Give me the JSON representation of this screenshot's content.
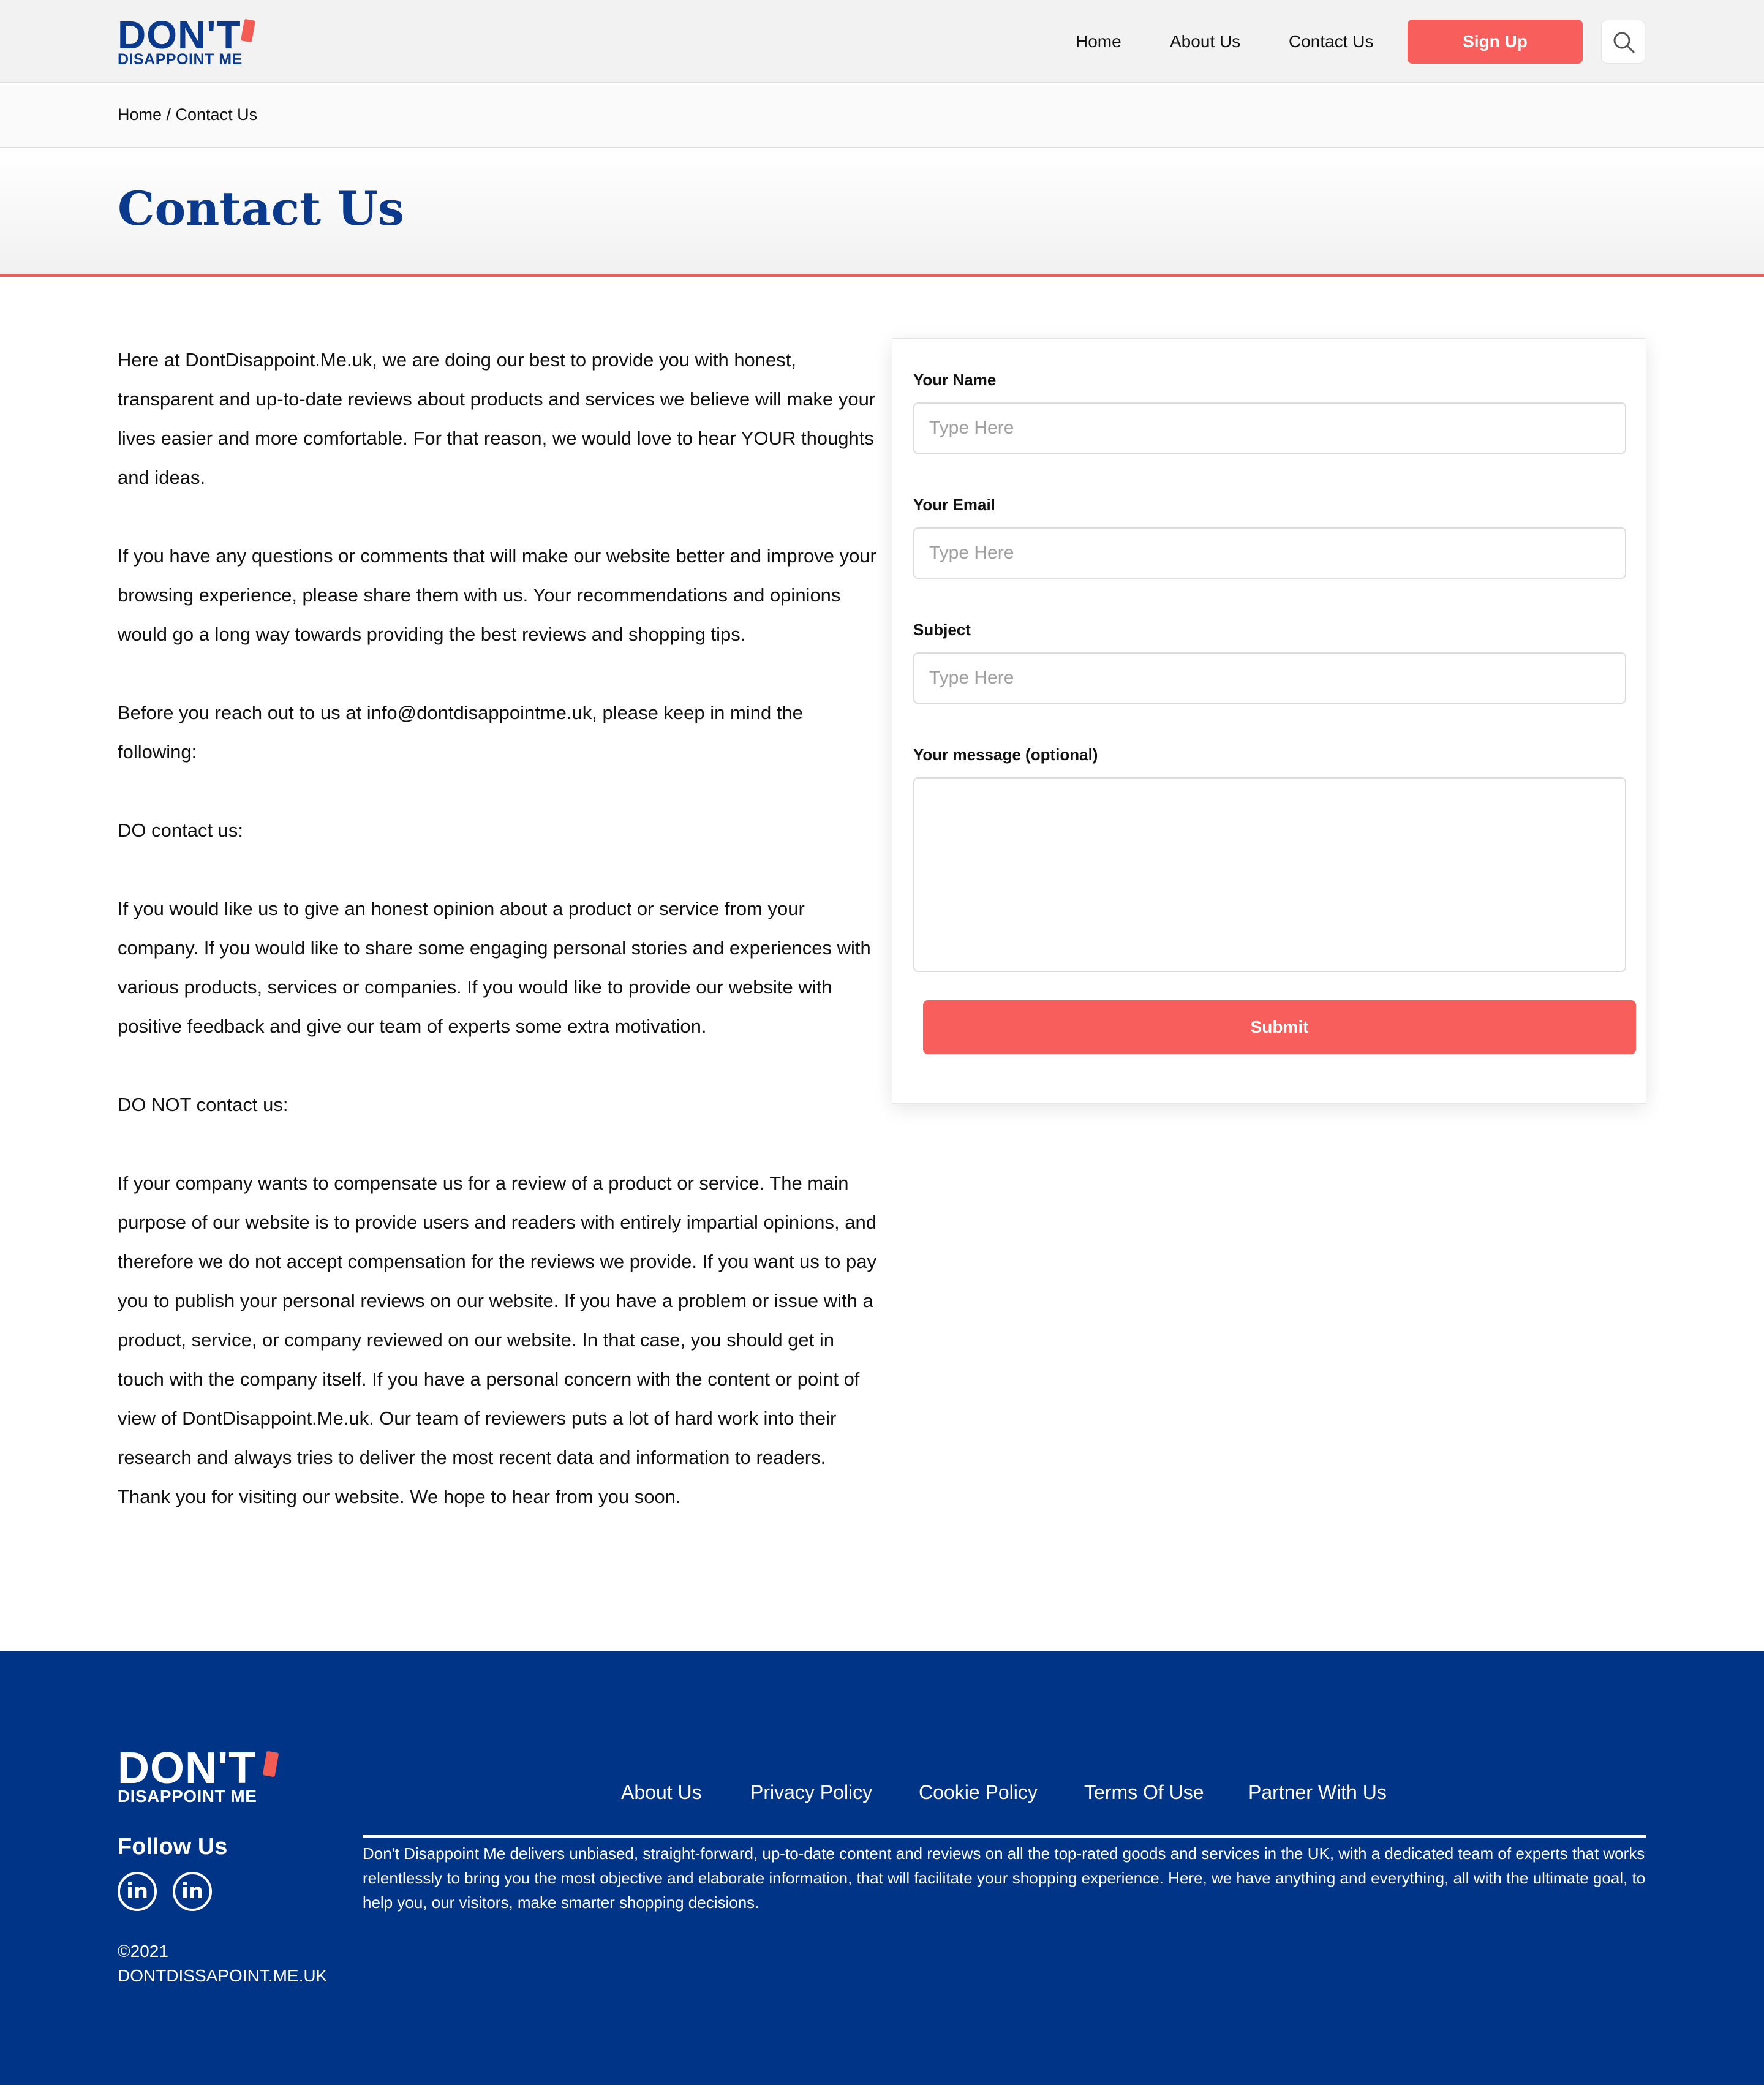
{
  "brand": {
    "logo_top": "DON'T",
    "logo_bottom": "DISAPPOINT ME"
  },
  "nav": {
    "home": "Home",
    "about": "About Us",
    "contact": "Contact Us",
    "signup": "Sign Up",
    "search_icon": "search-icon"
  },
  "breadcrumb": "Home / Contact Us",
  "page_title": "Contact Us",
  "content": {
    "paragraphs": [
      "Here at DontDisappoint.Me.uk, we are doing our best to provide you with honest, transparent and up-to-date reviews about products and services we believe will make your lives easier and more comfortable. For that reason, we would love to hear YOUR thoughts and ideas.",
      "If you have any questions or comments that will make our website better and improve your browsing experience, please share them with us. Your recommendations and opinions would go a long way towards providing the best reviews and shopping tips.",
      "Before you reach out to us at info@dontdisappointme.uk, please keep in mind the following:",
      "DO contact us:",
      "If you would like us to give an honest opinion about a product or service from your company. If you would like to share some engaging personal stories and experiences with various products, services or companies. If you would like to provide our website with positive feedback and give our team of experts some extra motivation.",
      "DO NOT contact us:",
      "If your company wants to compensate us for a review of a product or service. The main purpose of our website is to provide users and readers with entirely impartial opinions, and therefore we do not accept compensation for the reviews we provide. If you want us to pay you to publish your personal reviews on our website. If you have a problem or issue with a product, service, or company reviewed on our website. In that case, you should get in touch with the company itself. If you have a personal concern with the content or point of view of DontDisappoint.Me.uk. Our team of reviewers puts a lot of hard work into their research and always tries to deliver the most recent data and information to readers. Thank you for visiting our website. We hope to hear from you soon."
    ]
  },
  "form": {
    "name_label": "Your Name",
    "name_placeholder": "Type Here",
    "name_value": "",
    "email_label": "Your Email",
    "email_placeholder": "Type Here",
    "email_value": "",
    "subject_label": "Subject",
    "subject_placeholder": "Type Here",
    "subject_value": "",
    "message_label": "Your message (optional)",
    "message_value": "",
    "submit": "Submit"
  },
  "footer": {
    "logo_top": "DON'T",
    "logo_bottom": "DISAPPOINT ME",
    "follow_us": "Follow Us",
    "social": [
      {
        "icon": "linkedin-icon",
        "glyph": "in"
      },
      {
        "icon": "linkedin-icon",
        "glyph": "in"
      }
    ],
    "copyright_year": "©2021",
    "copyright_site": "DONTDISSAPOINT.ME.UK",
    "links": [
      "About Us",
      "Privacy Policy",
      "Cookie Policy",
      "Terms Of Use",
      "Partner With Us"
    ],
    "about_text": "Don't Disappoint Me delivers unbiased, straight-forward, up-to-date content and reviews on all the top-rated goods and services in the UK, with a dedicated team of experts that works relentlessly to bring you the most objective and elaborate information, that will facilitate your shopping experience. Here, we have anything and everything, all with the ultimate goal, to help you, our visitors, make smarter shopping decisions."
  },
  "colors": {
    "brand_blue": "#0b3a8c",
    "footer_blue": "#003487",
    "accent_red": "#f75e5c"
  }
}
